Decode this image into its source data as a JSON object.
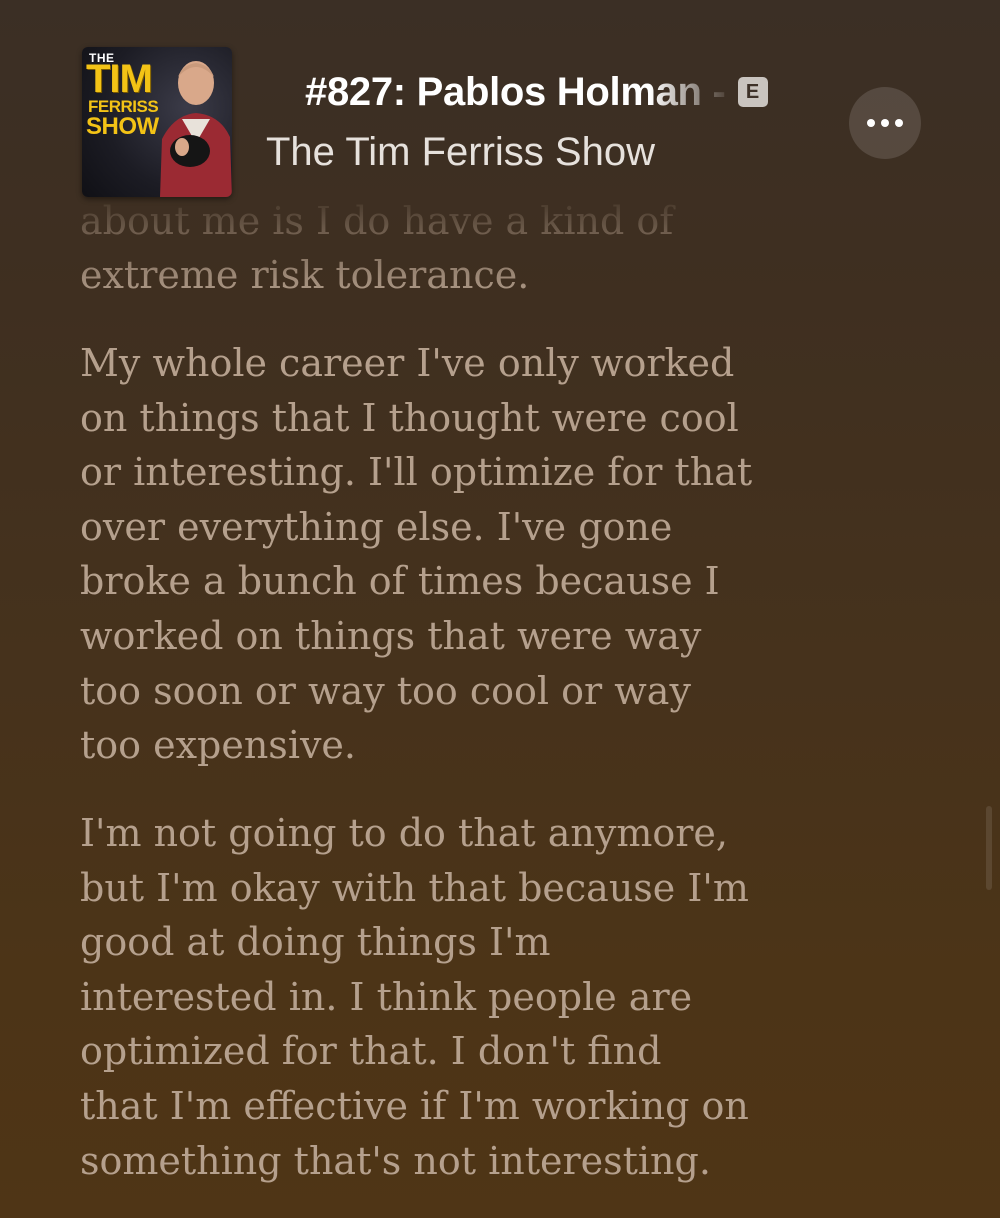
{
  "header": {
    "artwork": {
      "the": "THE",
      "tim": "TIM",
      "ferriss": "FERRISS",
      "show": "SHOW"
    },
    "episode_title": "#827: Pablos Holman -",
    "explicit_badge": "E",
    "show_name": "The Tim Ferriss Show",
    "more_button_icon": "ellipsis-icon"
  },
  "transcript": {
    "faded_lines": [
      "about me is I do have a kind of",
      "extreme risk tolerance."
    ],
    "paragraphs": [
      {
        "lines": [
          "My whole career I've only worked",
          "on things that I thought were cool",
          "or interesting. I'll optimize for that",
          "over everything else. I've gone",
          "broke a bunch of times because I",
          "worked on things that were way",
          "too soon or way too cool or way",
          "too expensive."
        ]
      },
      {
        "lines": [
          "I'm not going to do that anymore,",
          "but I'm okay with that because I'm",
          "good at doing things I'm",
          "interested in. I think people are",
          "optimized for that. I don't find",
          "that I'm effective if I'm working on",
          "something that's not interesting."
        ]
      }
    ]
  },
  "colors": {
    "transcript_text": "#b5a08d",
    "title_text": "#ffffff",
    "badge_bg": "#c9c4bf",
    "artwork_accent": "#f3c316"
  }
}
